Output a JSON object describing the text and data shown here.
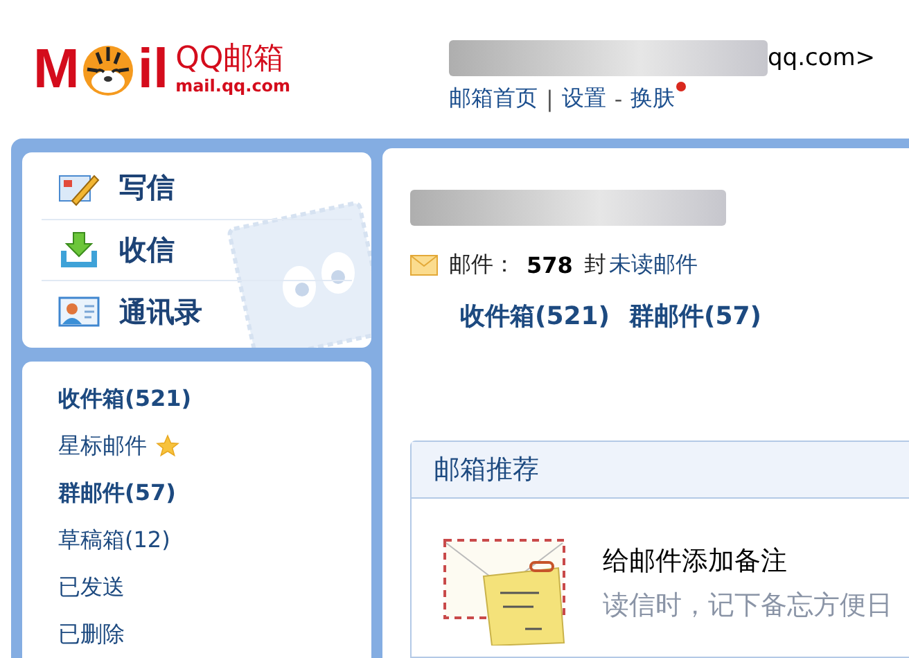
{
  "header": {
    "logo": {
      "mark_start": "M",
      "mark_end": "il",
      "brand": "QQ邮箱",
      "domain": "mail.qq.com"
    },
    "account": {
      "address_tail": "qq.com>"
    },
    "nav": [
      {
        "kind": "link",
        "text": "邮箱首页",
        "dot": false
      },
      {
        "kind": "separator",
        "text": "|"
      },
      {
        "kind": "link",
        "text": "设置",
        "dot": false
      },
      {
        "kind": "separator",
        "text": "-"
      },
      {
        "kind": "link",
        "text": "换肤",
        "dot": true
      }
    ]
  },
  "actions": [
    {
      "kind": "compose",
      "label": "写信"
    },
    {
      "kind": "receive",
      "label": "收信"
    },
    {
      "kind": "contacts",
      "label": "通讯录"
    }
  ],
  "folders": [
    {
      "label": "收件箱(521)",
      "bold": true,
      "starred": false
    },
    {
      "label": "星标邮件",
      "bold": false,
      "starred": true
    },
    {
      "label": "群邮件(57)",
      "bold": true,
      "starred": false
    },
    {
      "label": "草稿箱(12)",
      "bold": false,
      "starred": false
    },
    {
      "label": "已发送",
      "bold": false,
      "starred": false
    },
    {
      "label": "已删除",
      "bold": false,
      "starred": false
    }
  ],
  "summary": {
    "label": "邮件：",
    "count": "578",
    "unit": "封",
    "link": "未读邮件"
  },
  "quick_links": [
    "收件箱(521)",
    "群邮件(57)"
  ],
  "recommend": {
    "title": "邮箱推荐",
    "items": [
      {
        "title": "给邮件添加备注",
        "description": "读信时，记下备忘方便日"
      }
    ]
  }
}
